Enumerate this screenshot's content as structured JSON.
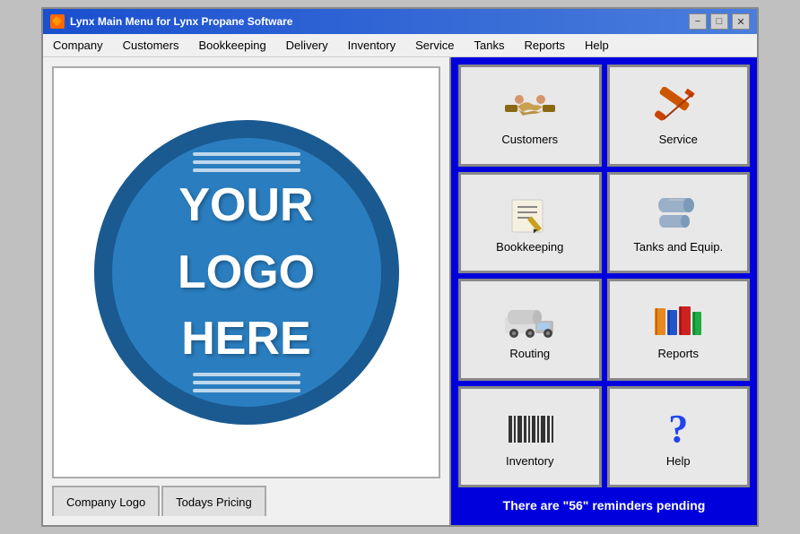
{
  "window": {
    "title": "Lynx Main Menu for Lynx Propane Software",
    "icon": "🔶"
  },
  "title_controls": {
    "minimize": "−",
    "maximize": "□",
    "close": "✕"
  },
  "menu": {
    "items": [
      {
        "label": "Company",
        "id": "company"
      },
      {
        "label": "Customers",
        "id": "customers"
      },
      {
        "label": "Bookkeeping",
        "id": "bookkeeping"
      },
      {
        "label": "Delivery",
        "id": "delivery"
      },
      {
        "label": "Inventory",
        "id": "inventory"
      },
      {
        "label": "Service",
        "id": "service"
      },
      {
        "label": "Tanks",
        "id": "tanks"
      },
      {
        "label": "Reports",
        "id": "reports"
      },
      {
        "label": "Help",
        "id": "help"
      }
    ]
  },
  "logo": {
    "line1": "YOUR",
    "line2": "LOGO",
    "line3": "HERE"
  },
  "bottom_tabs": [
    {
      "label": "Company Logo",
      "id": "company-logo"
    },
    {
      "label": "Todays Pricing",
      "id": "todays-pricing"
    }
  ],
  "grid_buttons": [
    {
      "label": "Customers",
      "icon": "🤝",
      "id": "customers"
    },
    {
      "label": "Service",
      "icon": "🔧",
      "id": "service"
    },
    {
      "label": "Bookkeeping",
      "icon": "📋",
      "id": "bookkeeping"
    },
    {
      "label": "Tanks and Equip.",
      "icon": "🛢",
      "id": "tanks"
    },
    {
      "label": "Routing",
      "icon": "🚛",
      "id": "routing"
    },
    {
      "label": "Reports",
      "icon": "📚",
      "id": "reports"
    },
    {
      "label": "Inventory",
      "icon": "📊",
      "id": "inventory"
    },
    {
      "label": "Help",
      "icon": "❓",
      "id": "help"
    }
  ],
  "reminders": {
    "text": "There are \"56\" reminders pending"
  }
}
